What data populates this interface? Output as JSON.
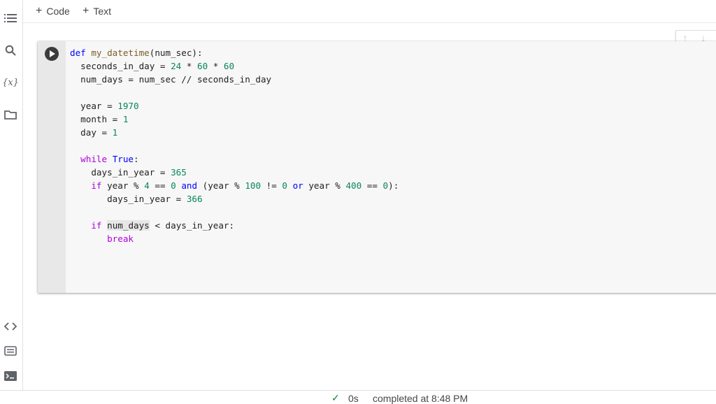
{
  "toolbar": {
    "add_code_label": "Code",
    "add_text_label": "Text"
  },
  "sidebar": {
    "top_icons": [
      "table-of-contents-icon",
      "search-icon",
      "variables-icon",
      "folder-icon"
    ],
    "bottom_icons": [
      "code-snippets-icon",
      "command-palette-icon",
      "terminal-icon"
    ],
    "variables_glyph": "{x}"
  },
  "cell": {
    "code_lines": [
      "def my_datetime(num_sec):",
      "  seconds_in_day = 24 * 60 * 60",
      "  num_days = num_sec // seconds_in_day",
      "",
      "  year = 1970",
      "  month = 1",
      "  day = 1",
      "",
      "  while True:",
      "    days_in_year = 365",
      "    if year % 4 == 0 and (year % 100 != 0 or year % 400 == 0):",
      "       days_in_year = 366",
      "",
      "    if num_days < days_in_year:",
      "       break"
    ],
    "move_up_glyph": "↑",
    "move_down_glyph": "↓"
  },
  "status": {
    "check_glyph": "✓",
    "duration": "0s",
    "completed": "completed at 8:48 PM"
  },
  "colors": {
    "keyword": "#0000ff",
    "control_keyword": "#af00db",
    "function_name": "#795e26",
    "number": "#098658",
    "success": "#188038"
  }
}
